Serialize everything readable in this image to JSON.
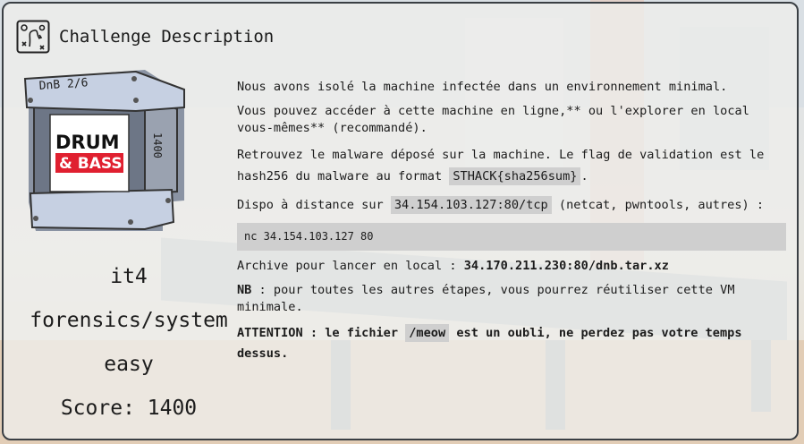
{
  "header": {
    "title": "Challenge Description"
  },
  "badge": {
    "top_text": "DnB 2/6",
    "side_text": "1400",
    "logo_line1": "DRUM",
    "logo_line2": "& BASS"
  },
  "challenge": {
    "author": "it4",
    "category": "forensics/system",
    "difficulty": "easy",
    "score_text": "Score: 1400"
  },
  "description": {
    "p1": "Nous avons isolé la machine infectée dans un environnement minimal.",
    "p2": "Vous pouvez accéder à cette machine en ligne,** ou l'explorer en local vous-mêmes** (recommandé).",
    "p3_before": "Retrouvez le malware déposé sur la machine. Le flag de validation est le hash256 du malware au format ",
    "p3_code": "STHACK{sha256sum}",
    "p3_after": ".",
    "p4_before": "Dispo à distance sur ",
    "p4_code": "34.154.103.127:80/tcp",
    "p4_after": " (netcat, pwntools, autres) :",
    "command": "nc 34.154.103.127 80",
    "p5_before": "Archive pour lancer en local : ",
    "p5_bold": "34.170.211.230:80/dnb.tar.xz",
    "p6_bold": "NB",
    "p6_after": " : pour toutes les autres étapes, vous pourrez réutiliser cette VM minimale.",
    "p7_bold1": "ATTENTION : le fichier ",
    "p7_code": "/meow",
    "p7_bold2": " est un oubli, ne perdez pas votre temps dessus."
  }
}
